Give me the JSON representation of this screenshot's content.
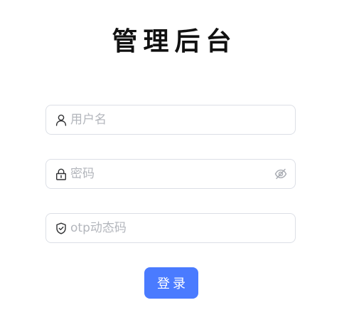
{
  "page": {
    "title": "管理后台"
  },
  "form": {
    "username": {
      "placeholder": "用户名",
      "value": "",
      "icon": "user-icon"
    },
    "password": {
      "placeholder": "密码",
      "value": "",
      "icon": "lock-icon",
      "toggle_icon": "eye-off-icon"
    },
    "otp": {
      "placeholder": "otp动态码",
      "value": "",
      "icon": "shield-check-icon"
    },
    "submit_label": "登录"
  },
  "colors": {
    "primary": "#4a7bff",
    "border": "#dcdfe6",
    "placeholder": "#b3b6bc",
    "title": "#111111"
  }
}
